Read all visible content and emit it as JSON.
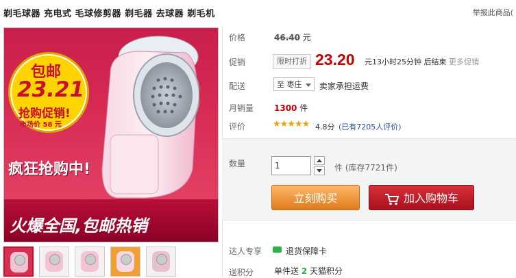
{
  "header": {
    "title": "剃毛球器 充电式 毛球修剪器 剃毛器 去球器 剃毛机",
    "report": "举报此商品(",
    "colors": {
      "accent": "#c40000",
      "buy": "#f39a3c",
      "cart": "#c4141e"
    }
  },
  "image": {
    "badge_top": "包邮",
    "badge_price": "23.21",
    "badge_line2": "抢购促销!",
    "badge_line3": "市场价 58 元",
    "crazy": "疯狂抢购中!",
    "banner": "火爆全国,包邮热销"
  },
  "thumbnails": [
    {
      "name": "thumb-1",
      "active": true
    },
    {
      "name": "thumb-2",
      "active": false
    },
    {
      "name": "thumb-3",
      "active": false
    },
    {
      "name": "thumb-4",
      "active": false
    },
    {
      "name": "thumb-5",
      "active": false
    }
  ],
  "price": {
    "label": "价格",
    "value": "46.40",
    "unit": "元"
  },
  "promo": {
    "label": "促销",
    "tag": "限时打折",
    "price": "23.20",
    "after": "元13小时25分钟 后结束",
    "more": "更多促销"
  },
  "delivery": {
    "label": "配送",
    "dest_prefix": "至",
    "dest": "枣庄",
    "note": "卖家承担运费"
  },
  "monthly": {
    "label": "月销量",
    "value": "1300",
    "unit": "件"
  },
  "review": {
    "label": "评价",
    "stars": 4.8,
    "score": "4.8分",
    "count": "(已有7205人评价)"
  },
  "quantity": {
    "label": "数量",
    "value": "1",
    "unit": "件",
    "stock": "(库存7721件)"
  },
  "buttons": {
    "buy": "立刻购买",
    "cart": "加入购物车"
  },
  "service": {
    "label": "达人专享",
    "item": "退货保障卡"
  },
  "points": {
    "label": "送积分",
    "text": "单件送",
    "value": "2",
    "unit": "天猫积分"
  }
}
